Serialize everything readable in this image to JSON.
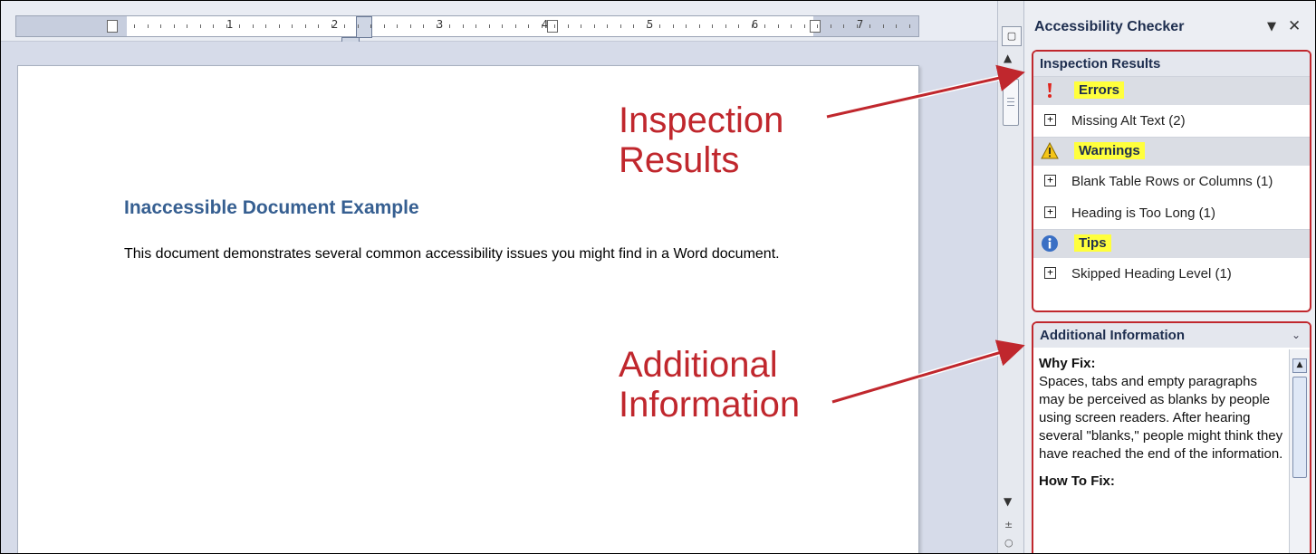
{
  "ruler": {
    "numbers": [
      "1",
      "2",
      "3",
      "4",
      "5",
      "6",
      "7"
    ]
  },
  "document": {
    "heading": "Inaccessible Document Example",
    "body": "This document demonstrates several common accessibility issues you might find in a Word document."
  },
  "pane": {
    "title": "Accessibility Checker",
    "menu_icon": "▼",
    "close_icon": "✕",
    "inspection": {
      "header": "Inspection Results",
      "categories": [
        {
          "label": "Errors",
          "icon": "error-exclamation-icon",
          "items": [
            "Missing Alt Text (2)"
          ]
        },
        {
          "label": "Warnings",
          "icon": "warning-triangle-icon",
          "items": [
            "Blank Table Rows or Columns (1)",
            "Heading is Too Long (1)"
          ]
        },
        {
          "label": "Tips",
          "icon": "info-circle-icon",
          "items": [
            "Skipped Heading Level (1)"
          ]
        }
      ]
    },
    "additional": {
      "header": "Additional Information",
      "why_label": "Why Fix:",
      "why_text": "Spaces, tabs and empty paragraphs may be perceived as blanks by people using screen readers. After hearing several \"blanks,\" people might think they have reached the end of the information.",
      "how_label": "How To Fix:"
    }
  },
  "annotations": {
    "inspection_line1": "Inspection",
    "inspection_line2": "Results",
    "additional_line1": "Additional",
    "additional_line2": "Information"
  },
  "colors": {
    "annotation_red": "#c0272d",
    "highlight_yellow": "#ffff3c",
    "heading_blue": "#365f91"
  }
}
